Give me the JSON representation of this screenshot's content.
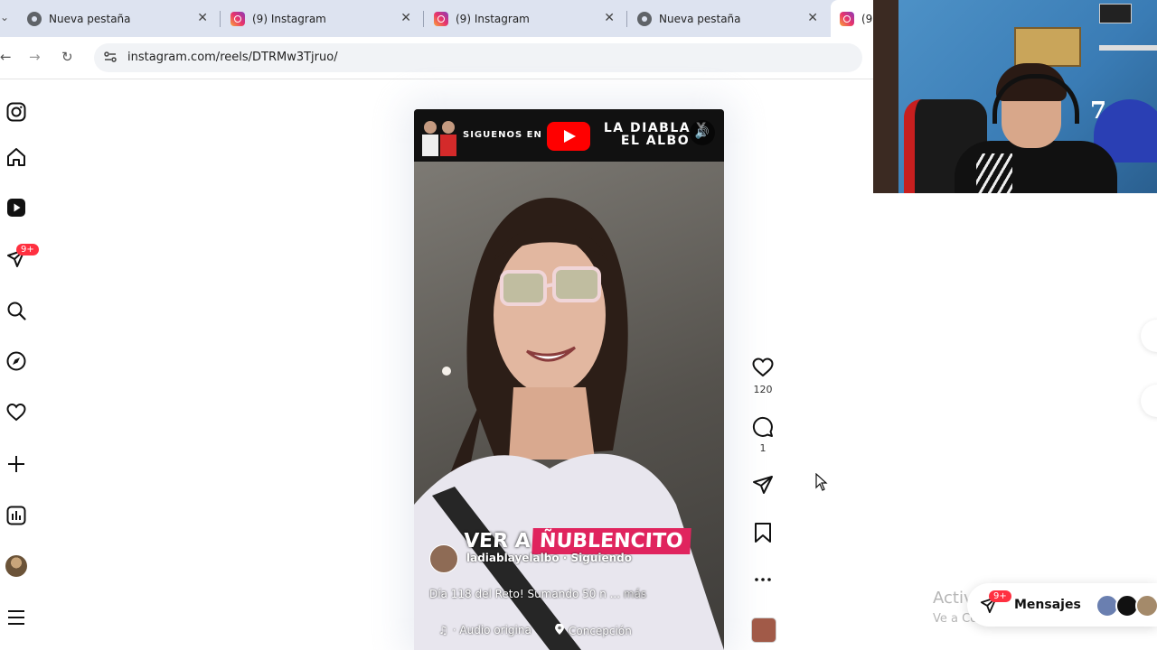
{
  "browser": {
    "tabs": [
      {
        "title": "Nueva pestaña",
        "favicon": "chrome-icon"
      },
      {
        "title": "(9) Instagram",
        "favicon": "instagram-icon"
      },
      {
        "title": "(9) Instagram",
        "favicon": "instagram-icon"
      },
      {
        "title": "Nueva pestaña",
        "favicon": "chrome-icon"
      },
      {
        "title": "(9",
        "favicon": "instagram-icon",
        "active": true
      }
    ],
    "url": "instagram.com/reels/DTRMw3Tjruo/"
  },
  "sidebar": {
    "items": [
      {
        "name": "instagram-logo-icon"
      },
      {
        "name": "home-icon"
      },
      {
        "name": "reels-icon",
        "active": true
      },
      {
        "name": "messages-icon",
        "badge": "9+"
      },
      {
        "name": "search-icon"
      },
      {
        "name": "explore-icon"
      },
      {
        "name": "notifications-heart-icon"
      },
      {
        "name": "create-plus-icon"
      },
      {
        "name": "dashboard-icon"
      },
      {
        "name": "profile-avatar"
      },
      {
        "name": "menu-icon"
      }
    ]
  },
  "reel": {
    "banner": {
      "follow_text": "SIGUENOS EN",
      "channel_line1": "LA DIABLA Y",
      "channel_line2": "EL ALBO"
    },
    "overlay_text_left": "VER A",
    "overlay_text_right": "ÑUBLENCITO",
    "author": "ladiablayelalbo · Siguiendo",
    "description": "Día 118 del Reto! Sumando 50 n ...",
    "more_label": "más",
    "audio_label": "· Audio origina",
    "location_label": "Concepción"
  },
  "actions": {
    "likes": "120",
    "comments": "1"
  },
  "messages": {
    "label": "Mensajes",
    "badge": "9+"
  },
  "watermark": {
    "line1": "Activar Windows",
    "line2": "Ve a Configuración para activar Windows."
  },
  "webcam": {
    "jersey_number": "7"
  },
  "colors": {
    "accent_red": "#ff3040",
    "overlay_pink": "#e0245e",
    "youtube_red": "#ff0000",
    "tabstrip": "#dde3f0"
  }
}
